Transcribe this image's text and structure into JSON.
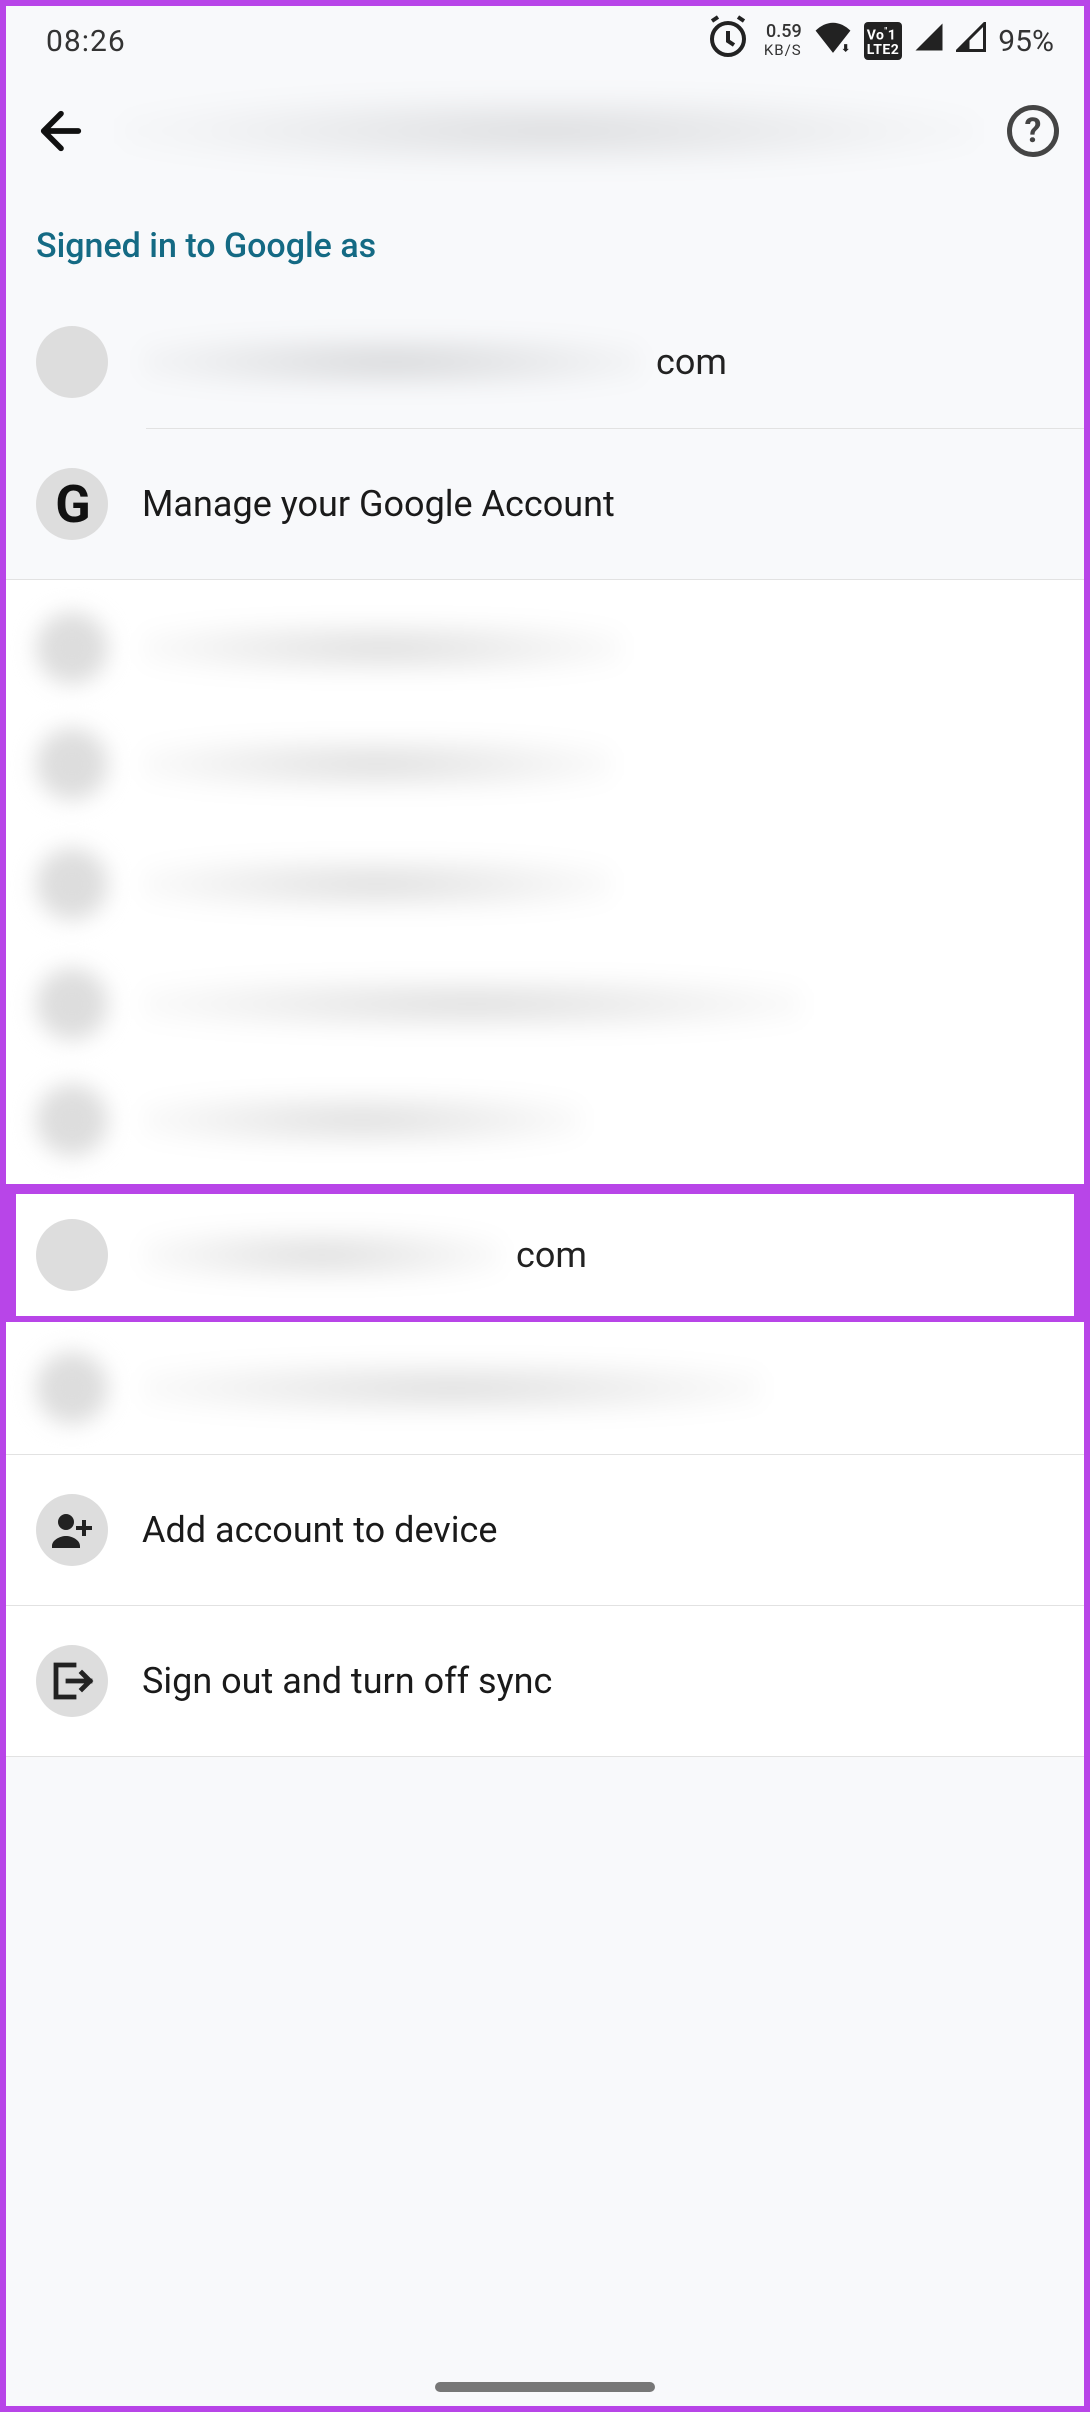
{
  "status": {
    "time": "08:26",
    "kbs_value": "0.59",
    "kbs_unit": "KB/S",
    "lte": "Vo\" 1\nLTE 2",
    "battery": "95%"
  },
  "section_header": "Signed in to Google as",
  "primary_account": {
    "suffix": "com"
  },
  "manage_label": "Manage your Google Account",
  "highlight_account": {
    "suffix": "com"
  },
  "actions": {
    "add_account": "Add account to device",
    "sign_out": "Sign out and turn off sync"
  }
}
